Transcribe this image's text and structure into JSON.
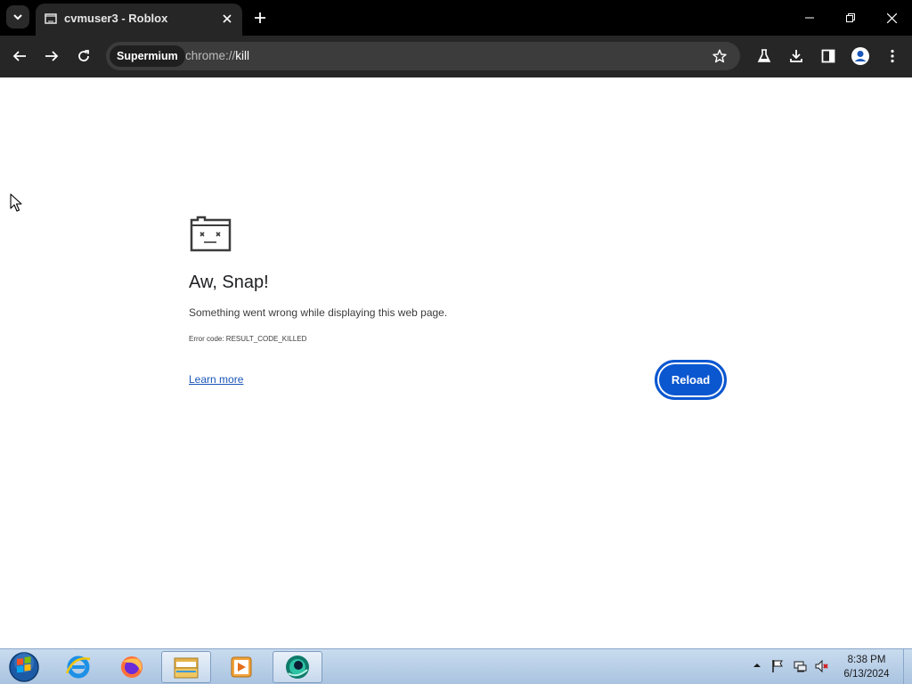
{
  "browser": {
    "tab": {
      "title": "cvmuser3 - Roblox"
    },
    "site_chip": "Supermium",
    "url": {
      "scheme": "chrome://",
      "host": "kill"
    }
  },
  "page": {
    "heading": "Aw, Snap!",
    "message": "Something went wrong while displaying this web page.",
    "error_code": "Error code: RESULT_CODE_KILLED",
    "learn_more": "Learn more",
    "reload_label": "Reload"
  },
  "taskbar": {
    "pinned": [
      "internet-explorer",
      "firefox",
      "file-explorer",
      "media-player",
      "supermium-browser"
    ],
    "clock": {
      "time": "8:38 PM",
      "date": "6/13/2024"
    }
  },
  "colors": {
    "titlebar": "#000000",
    "toolbar": "#262626",
    "omnibox": "#3c3c3c",
    "reload_button": "#0b57d0",
    "link": "#1a56b8"
  }
}
